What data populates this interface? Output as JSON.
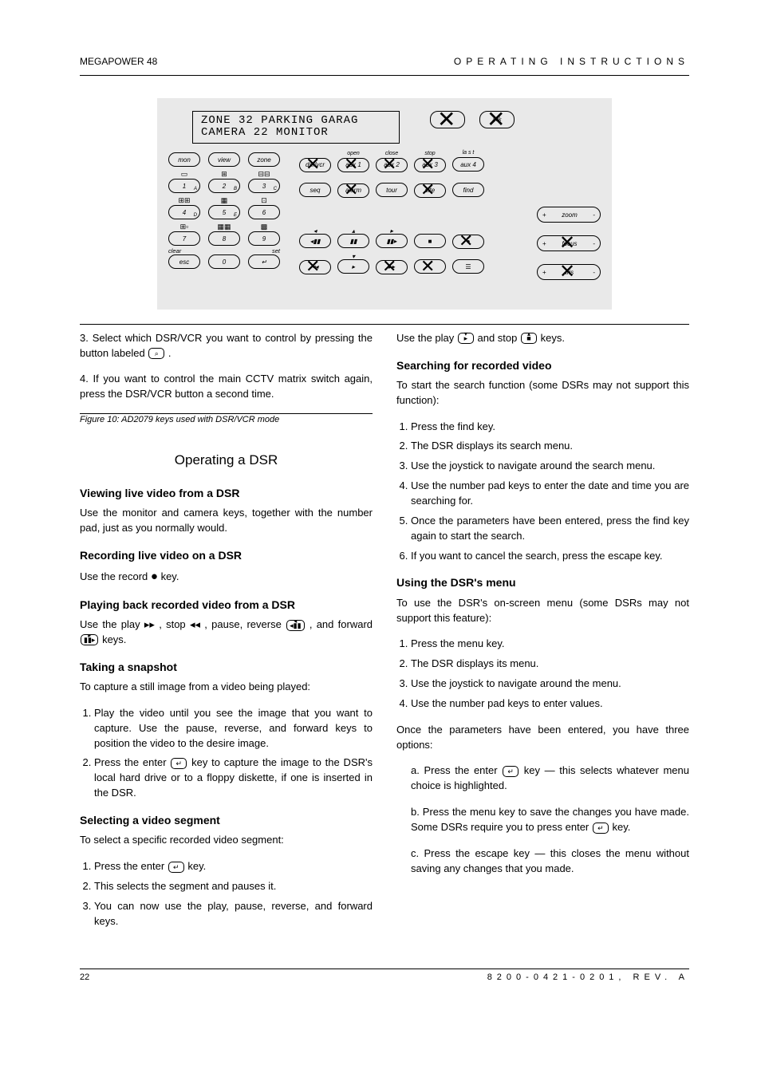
{
  "header": {
    "left": "MEGAPOWER 48",
    "right": "OPERATING INSTRUCTIONS"
  },
  "keyboard": {
    "display": {
      "line1": "ZONE 32   PARKING GARAG",
      "line2": "CAMERA 22    MONITOR"
    },
    "labels": {
      "mon": "mon",
      "view": "view",
      "zone": "zone",
      "row2_left": "clear",
      "row2_right": "set",
      "esc": "esc",
      "zero": "0",
      "dsrvcr": "dsr/vcr",
      "aux1": "aux 1",
      "aux2": "aux 2",
      "aux3": "aux 3",
      "aux4": "aux 4",
      "open": "open",
      "close": "close",
      "stop": "stop",
      "last": "la s t",
      "seq": "seq",
      "alarm": "alarm",
      "tour": "tour",
      "site": "site",
      "find": "find",
      "zoom": "zoom",
      "focus": "focus",
      "iris": "iris",
      "plus": "+",
      "minus": "-",
      "numpad": [
        "1",
        "2",
        "3",
        "4",
        "5",
        "6",
        "7",
        "8",
        "9"
      ],
      "numpad_sub": [
        "A",
        "B",
        "C",
        "D",
        "E",
        "",
        "",
        "",
        ""
      ]
    }
  },
  "figure_caption": "Figure 10: AD2079 keys used with DSR/VCR mode",
  "left_col": {
    "p1_a": "3. Select which DSR/VCR you want to control by pressing the button labeled ",
    "p1_b": ".",
    "p2": "4. If you want to control the main CCTV matrix switch again, press the DSR/VCR button a second time.",
    "h2": "Operating a DSR",
    "h3_view": "Viewing live video from a DSR",
    "p3": "Use the monitor and camera keys, together with the number pad, just as you normally would.",
    "h3_rec": "Recording live video on a DSR",
    "p4_a": "Use the record ",
    "p4_b": " key.",
    "h3_play": "Playing back recorded video from a DSR",
    "p5_a": "Use the play ",
    "p5_b": ", stop ",
    "p5_c": ", pause, reverse ",
    "p5_d": ", and forward ",
    "p5_e": " keys.",
    "h3_snap": "Taking a snapshot",
    "snap_intro": "To capture a still image from a video being played:",
    "snap_steps": [
      {
        "a": "Play the video until you see the image that you want to capture. Use the pause, reverse, and forward keys to position the video to the desire image."
      },
      {
        "a": "Press the enter ",
        "b": " key to capture the image to the DSR's local hard drive or to a floppy diskette, if one is inserted in the DSR."
      }
    ],
    "h3_seg": "Selecting a video segment",
    "seg_intro": "To select a specific recorded video segment:",
    "seg_steps": [
      {
        "a": "Press the enter ",
        "b": " key."
      },
      {
        "a": "This selects the segment and pauses it."
      },
      {
        "a": "You can now use the play, pause, reverse, and forward keys."
      }
    ]
  },
  "right_col": {
    "h3_find": "Searching for recorded video",
    "find_intro": "To start the search function (some DSRs may not support this function):",
    "find_steps": [
      "Press the find key.",
      "The DSR displays its search menu.",
      "Use the joystick to navigate around the search menu.",
      "Use the number pad keys to enter the date and time you are searching for.",
      "Once the parameters have been entered, press the find key again to start the search.",
      "If you want to cancel the search, press the escape key."
    ],
    "h3_menu": "Using the DSR's menu",
    "menu_intro": "To use the DSR's on-screen menu (some DSRs may not support this feature):",
    "menu_steps": [
      "Press the menu key.",
      "The DSR displays its menu.",
      "Use the joystick to navigate around the menu.",
      "Use the number pad keys to enter values."
    ],
    "menu_after": "Once the parameters have been entered, you have three options:",
    "menu_opts_labels": {
      "a": "a.",
      "b": "b.",
      "c": "c."
    },
    "menu_opts": [
      {
        "a": "Press the enter ",
        "b": " key — this selects whatever menu choice is highlighted."
      },
      {
        "a": "Press the menu key to save the changes you have made. Some DSRs require you to press enter ",
        "b": " key."
      },
      {
        "a": "Press the escape key — this closes the menu without saving any changes that you made."
      }
    ]
  },
  "footer": {
    "page": "22",
    "doc": "8200-0421-0201, REV. A"
  }
}
